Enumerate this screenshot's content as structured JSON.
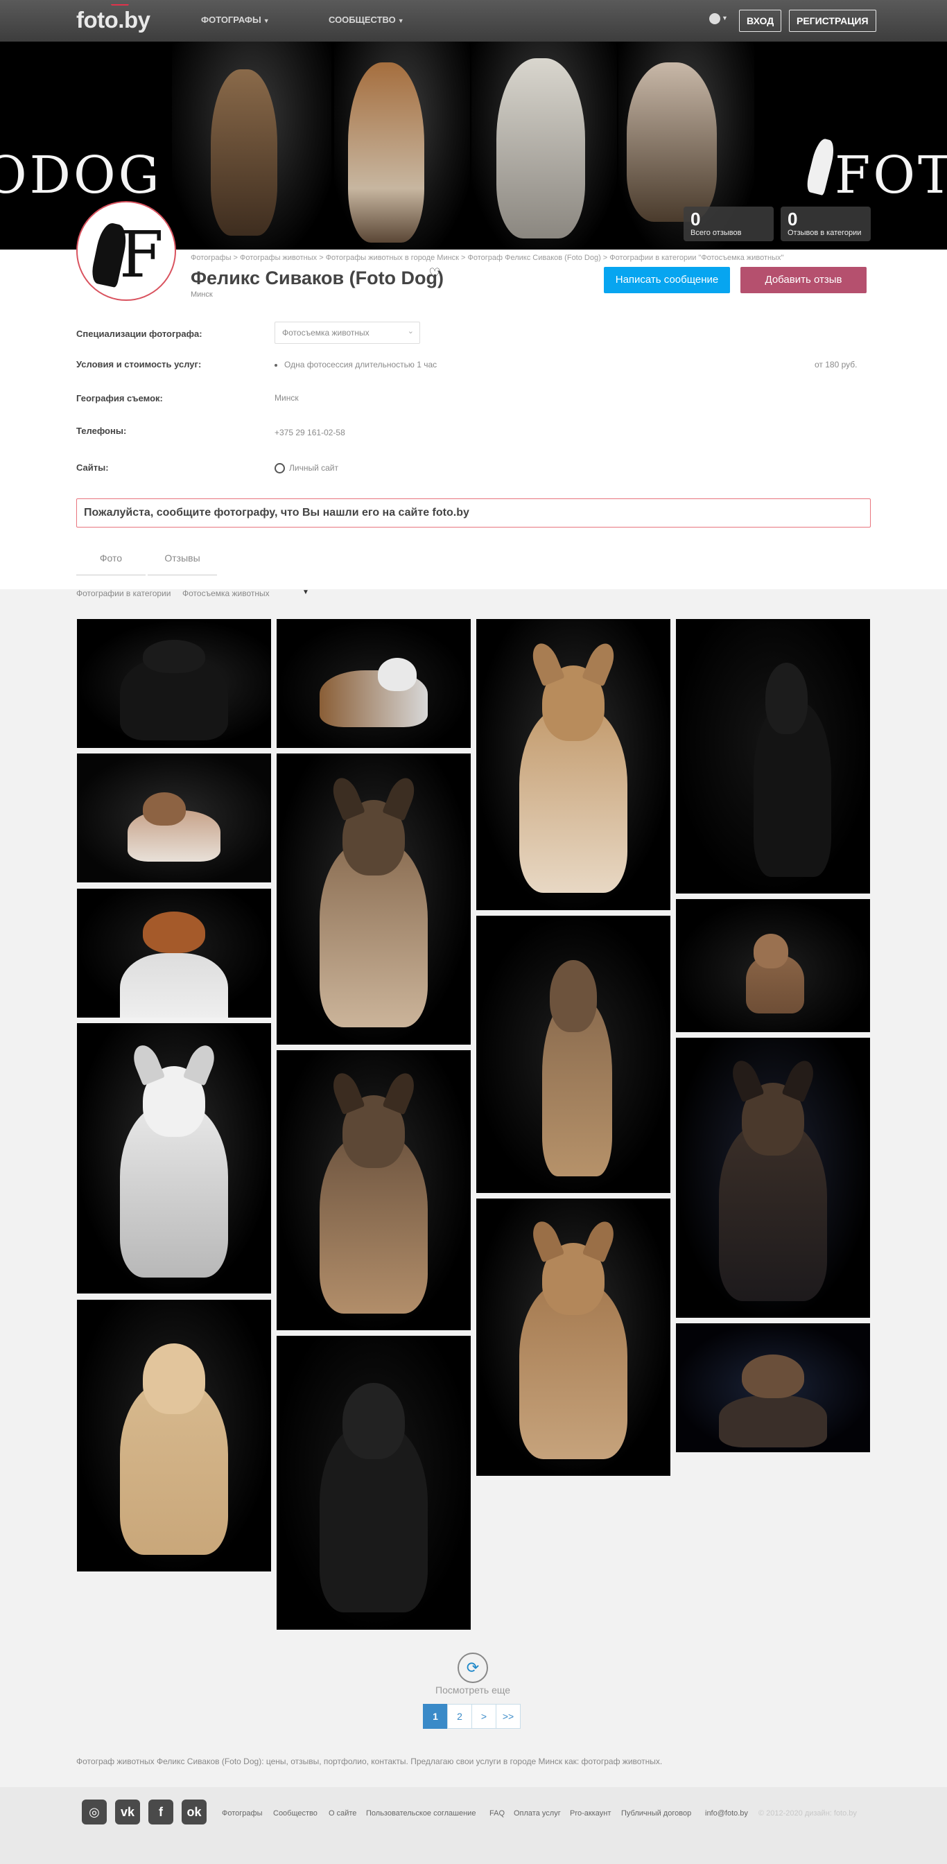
{
  "nav": {
    "logo": "foto.by",
    "menu_photos": "ФОТОГРАФЫ",
    "menu_community": "СООБЩЕСТВО",
    "login": "ВХОД",
    "register": "РЕГИСТРАЦИЯ"
  },
  "banner": {
    "left_text": "ODOG",
    "right_text": "FOT",
    "stats": [
      {
        "value": "0",
        "label": "Всего отзывов"
      },
      {
        "value": "0",
        "label": "Отзывов в категории"
      }
    ]
  },
  "profile": {
    "breadcrumbs": "Фотографы > Фотографы животных > Фотографы животных в городе Минск > Фотограф Феликс Сиваков (Foto Dog) > Фотографии в категории \"Фотосъемка животных\"",
    "name": "Феликс Сиваков (Foto Dog)",
    "city": "Минск",
    "btn_message": "Написать сообщение",
    "btn_review": "Добавить отзыв",
    "spec_label": "Специализации фотографа:",
    "spec_value": "Фотосъемка животных",
    "terms_label": "Условия и стоимость услуг:",
    "terms_item": "Одна фотосессия длительностью 1 час",
    "terms_price": "от 180 руб.",
    "geo_label": "География съемок:",
    "geo_value": "Минск",
    "phones_label": "Телефоны:",
    "phones_value": "+375 29 161-02-58",
    "sites_label": "Сайты:",
    "sites_value": "Личный сайт",
    "notice": "Пожалуйста, сообщите фотографу, что Вы нашли его на сайте foto.by"
  },
  "gallery": {
    "tabs": [
      "Фото",
      "Отзывы"
    ],
    "filter_label": "Фотографии в категории",
    "filter_value": "Фотосъемка животных",
    "more": "Посмотреть еще",
    "pages": [
      "1",
      "2",
      ">",
      ">>"
    ]
  },
  "seo_text": "Фотограф животных Феликс Сиваков (Foto Dog): цены, отзывы, портфолио, контакты. Предлагаю свои услуги в городе Минск как: фотограф животных.",
  "footer": {
    "social": [
      "instagram-icon",
      "vk-icon",
      "facebook-icon",
      "odnoklassniki-icon"
    ],
    "social_glyphs": [
      "◎",
      "vk",
      "f",
      "ok"
    ],
    "links": [
      "Фотографы",
      "Сообщество",
      "О сайте",
      "Пользовательское соглашение",
      "FAQ",
      "Оплата услуг",
      "Pro-аккаунт",
      "Публичный договор",
      "info@foto.by"
    ],
    "copyright": "© 2012-2020 дизайн: foto.by"
  }
}
